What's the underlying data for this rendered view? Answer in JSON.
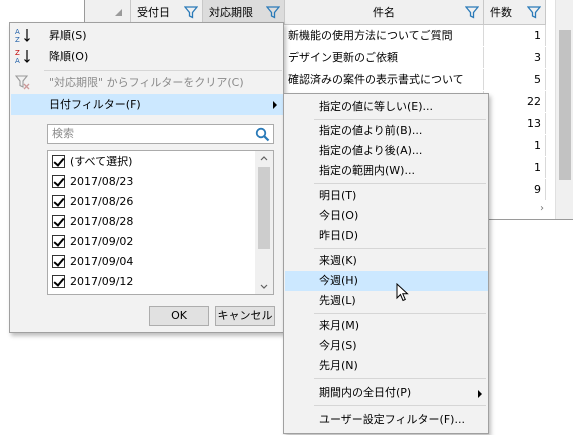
{
  "grid": {
    "columns": [
      {
        "label": "受付日"
      },
      {
        "label": "対応期限"
      },
      {
        "label": "件名"
      },
      {
        "label": "件数"
      }
    ],
    "rows": [
      {
        "title": "新機能の使用方法についてご質問",
        "count": "1"
      },
      {
        "title": "デザイン更新のご依頼",
        "count": "3"
      },
      {
        "title": "確認済みの案件の表示書式について",
        "count": "5"
      },
      {
        "title": "",
        "count": "22"
      },
      {
        "title": "",
        "count": "13"
      },
      {
        "title": "",
        "count": "1"
      },
      {
        "title": "",
        "count": "1"
      },
      {
        "title": "",
        "count": "9"
      }
    ]
  },
  "filter_menu": {
    "sort_asc": "昇順(S)",
    "sort_desc": "降順(O)",
    "clear_filter": "\"対応期限\" からフィルターをクリア(C)",
    "date_filter": "日付フィルター(F)",
    "search_placeholder": "検索",
    "values": [
      {
        "label": "(すべて選択)",
        "checked": true
      },
      {
        "label": "2017/08/23",
        "checked": true
      },
      {
        "label": "2017/08/26",
        "checked": true
      },
      {
        "label": "2017/08/28",
        "checked": true
      },
      {
        "label": "2017/09/02",
        "checked": true
      },
      {
        "label": "2017/09/04",
        "checked": true
      },
      {
        "label": "2017/09/12",
        "checked": true
      }
    ],
    "ok_label": "OK",
    "cancel_label": "キャンセル"
  },
  "date_submenu": {
    "items": [
      "指定の値に等しい(E)...",
      "指定の値より前(B)...",
      "指定の値より後(A)...",
      "指定の範囲内(W)...",
      "明日(T)",
      "今日(O)",
      "昨日(D)",
      "来週(K)",
      "今週(H)",
      "先週(L)",
      "来月(M)",
      "今月(S)",
      "先月(N)",
      "期間内の全日付(P)",
      "ユーザー設定フィルター(F)..."
    ],
    "highlighted": "今週(H)"
  },
  "colors": {
    "highlight": "#cce8ff",
    "filter_icon": "#2a7ab8",
    "sort_red": "#c00000",
    "sort_blue": "#1f5fa8"
  }
}
